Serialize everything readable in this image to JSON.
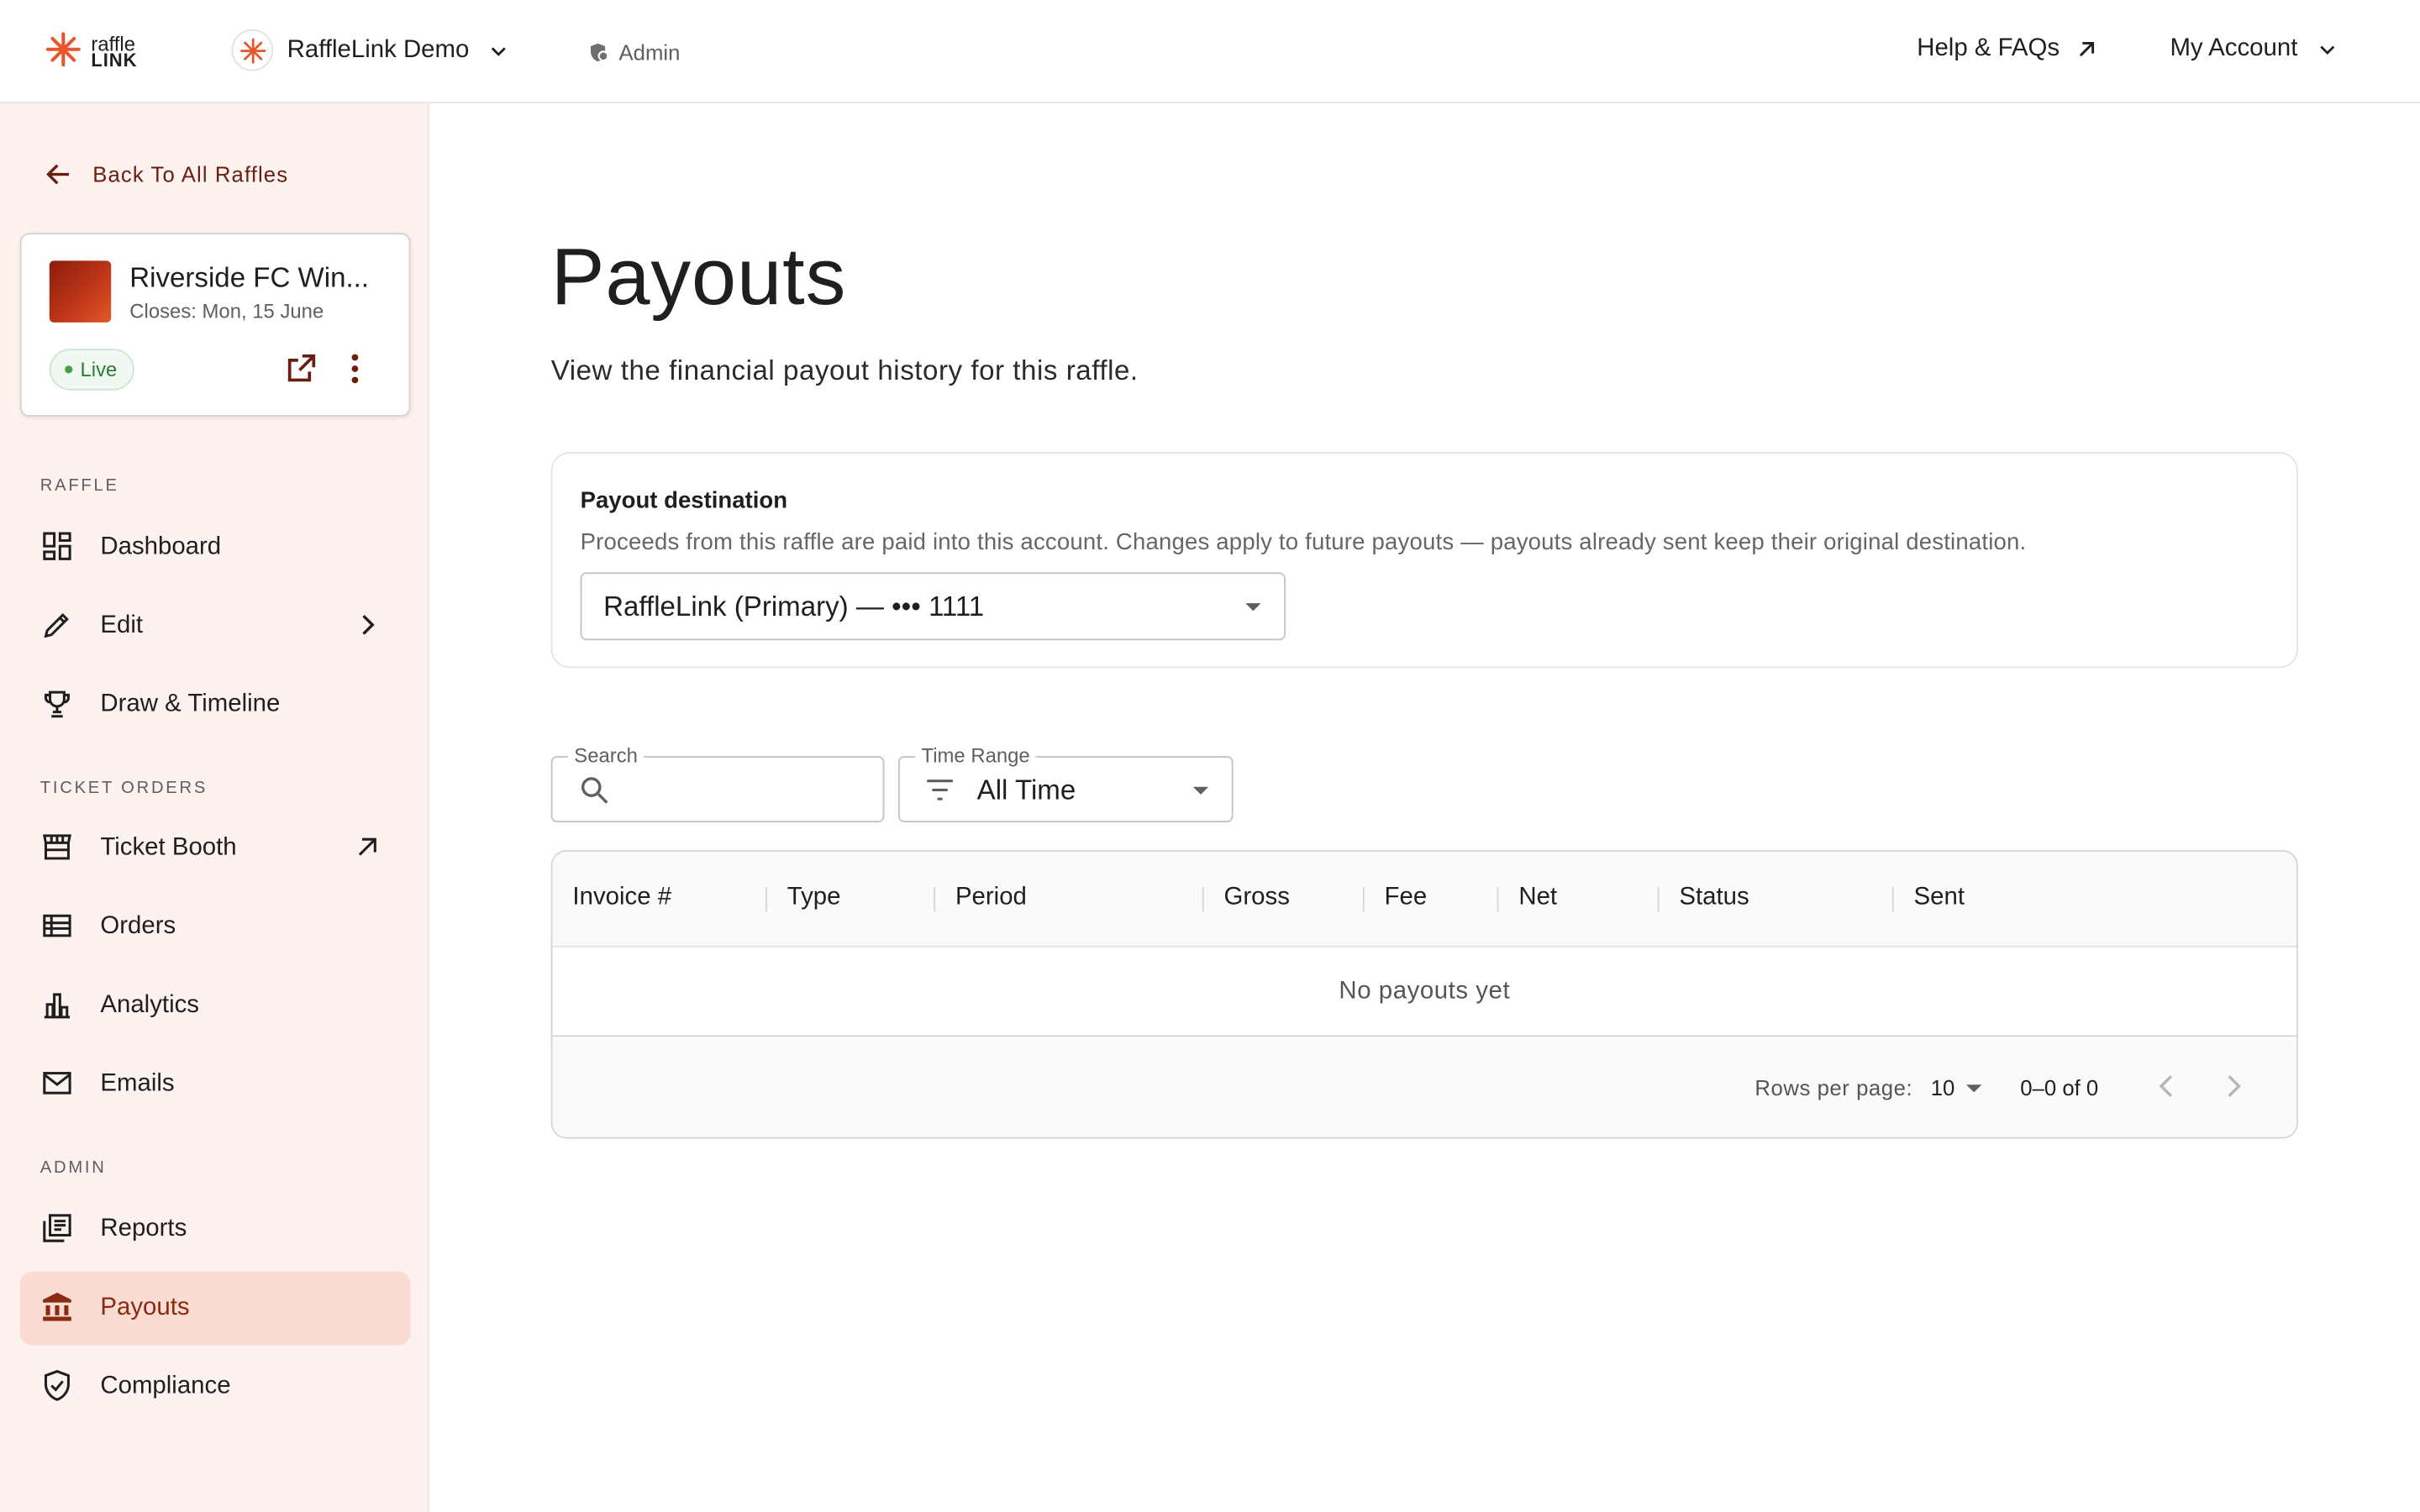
{
  "brand": {
    "line1": "raffle",
    "line2": "LINK",
    "accent_color": "#e8552b"
  },
  "header": {
    "org_name": "RaffleLink Demo",
    "admin_label": "Admin",
    "help_label": "Help & FAQs",
    "account_label": "My Account"
  },
  "sidebar": {
    "back_label": "Back To All Raffles",
    "raffle": {
      "title": "Riverside FC Win...",
      "closes": "Closes: Mon, 15 June",
      "status": "Live"
    },
    "sections": {
      "raffle": "RAFFLE",
      "ticket_orders": "TICKET ORDERS",
      "admin": "ADMIN"
    },
    "items": {
      "dashboard": "Dashboard",
      "edit": "Edit",
      "draw": "Draw & Timeline",
      "ticket_booth": "Ticket Booth",
      "orders": "Orders",
      "analytics": "Analytics",
      "emails": "Emails",
      "reports": "Reports",
      "payouts": "Payouts",
      "compliance": "Compliance"
    },
    "active_item": "payouts",
    "active_bg": "#fbdcd3",
    "sidebar_bg": "#fdf2ef"
  },
  "main": {
    "title": "Payouts",
    "subtitle": "View the financial payout history for this raffle.",
    "destination": {
      "title": "Payout destination",
      "description": "Proceeds from this raffle are paid into this account. Changes apply to future payouts — payouts already sent keep their original destination.",
      "selected": "RaffleLink (Primary) — ••• 1111"
    },
    "filters": {
      "search_label": "Search",
      "search_value": "",
      "range_label": "Time Range",
      "range_value": "All Time"
    },
    "table": {
      "columns": [
        "Invoice #",
        "Type",
        "Period",
        "Gross",
        "Fee",
        "Net",
        "Status",
        "Sent"
      ],
      "rows": [],
      "empty_text": "No payouts yet",
      "rows_per_page_label": "Rows per page:",
      "rows_per_page": "10",
      "range_text": "0–0 of 0"
    }
  }
}
